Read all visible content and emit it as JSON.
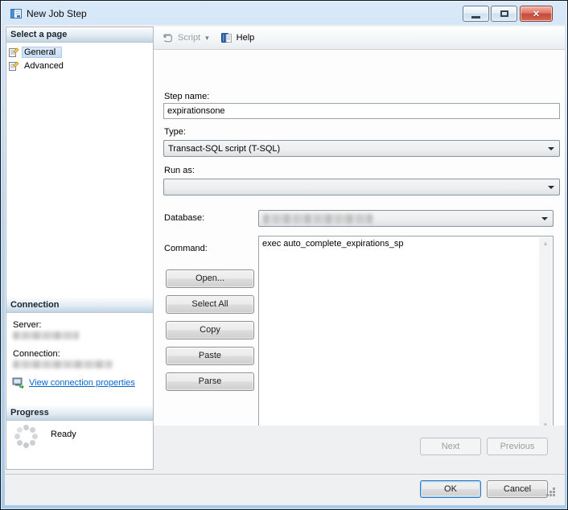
{
  "window": {
    "title": "New Job Step"
  },
  "icons": {
    "close_glyph": "✕",
    "toolbar_dropdown_glyph": "▾",
    "scroll_up_glyph": "▲",
    "scroll_down_glyph": "▼",
    "scroll_left_glyph": "◄",
    "scroll_right_glyph": "►"
  },
  "sidebar": {
    "select_a_page": {
      "header": "Select a page",
      "items": [
        {
          "label": "General",
          "selected": true
        },
        {
          "label": "Advanced",
          "selected": false
        }
      ]
    },
    "connection": {
      "header": "Connection",
      "server_label": "Server:",
      "server_value_redacted": true,
      "connection_label": "Connection:",
      "connection_value_redacted": true,
      "link_label": "View connection properties"
    },
    "progress": {
      "header": "Progress",
      "status": "Ready"
    }
  },
  "toolbar": {
    "script_label": "Script",
    "script_enabled": false,
    "help_label": "Help"
  },
  "form": {
    "step_name": {
      "label": "Step name:",
      "value": "expirationsone"
    },
    "type": {
      "label": "Type:",
      "value": "Transact-SQL script (T-SQL)"
    },
    "run_as": {
      "label": "Run as:",
      "value": ""
    },
    "database": {
      "label": "Database:",
      "value_redacted": true
    },
    "command": {
      "label": "Command:",
      "value": "exec auto_complete_expirations_sp"
    },
    "edit_buttons": [
      "Open...",
      "Select All",
      "Copy",
      "Paste",
      "Parse"
    ]
  },
  "wizard_nav": {
    "next_label": "Next",
    "previous_label": "Previous",
    "enabled": false
  },
  "dialog_buttons": {
    "ok_label": "OK",
    "cancel_label": "Cancel"
  },
  "colors": {
    "titlebar_top": "#d9e9f9",
    "titlebar_bottom": "#a9cbe9",
    "close_button_red": "#c44a38",
    "selection_highlight": "#c7ddf3",
    "section_header_bottom": "#c3d4e2",
    "link_blue": "#0a66cc",
    "client_gray": "#eef0f1"
  }
}
